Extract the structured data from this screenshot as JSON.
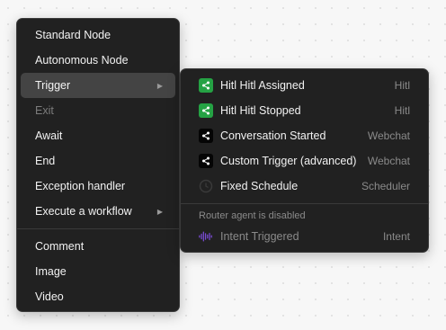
{
  "main_menu": {
    "group1": [
      {
        "label": "Standard Node"
      },
      {
        "label": "Autonomous Node"
      },
      {
        "label": "Trigger"
      },
      {
        "label": "Exit"
      },
      {
        "label": "Await"
      },
      {
        "label": "End"
      },
      {
        "label": "Exception handler"
      },
      {
        "label": "Execute a workflow"
      }
    ],
    "group2": [
      {
        "label": "Comment"
      },
      {
        "label": "Image"
      },
      {
        "label": "Video"
      }
    ]
  },
  "trigger_submenu": {
    "items": [
      {
        "label": "Hitl Hitl Assigned",
        "category": "Hitl",
        "icon": "share-icon"
      },
      {
        "label": "Hitl Hitl Stopped",
        "category": "Hitl",
        "icon": "share-icon"
      },
      {
        "label": "Conversation Started",
        "category": "Webchat",
        "icon": "share-icon"
      },
      {
        "label": "Custom Trigger (advanced)",
        "category": "Webchat",
        "icon": "share-icon"
      },
      {
        "label": "Fixed Schedule",
        "category": "Scheduler",
        "icon": "clock-icon"
      }
    ],
    "note": "Router agent is disabled",
    "disabled_item": {
      "label": "Intent Triggered",
      "category": "Intent",
      "icon": "waveform-icon"
    }
  },
  "colors": {
    "menu_bg": "#212121",
    "active_bg": "#444444",
    "green_icon": "#25a244",
    "waveform": "#7b4bd6"
  }
}
